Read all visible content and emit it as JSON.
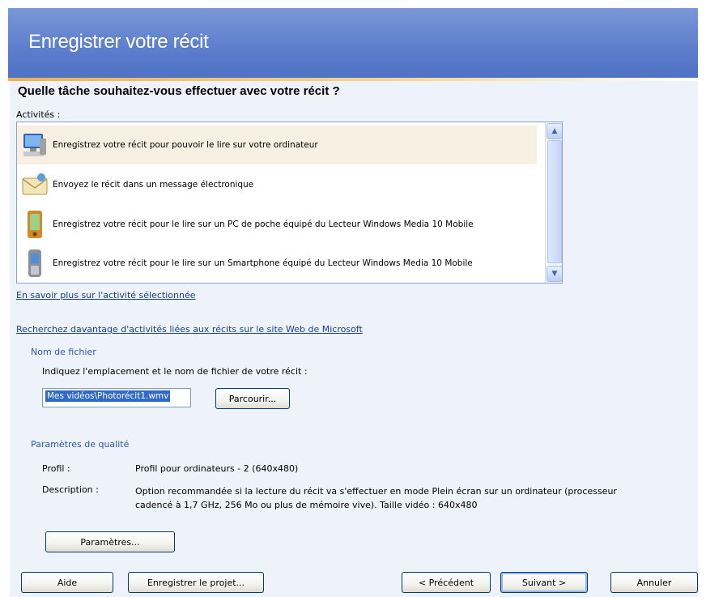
{
  "window": {
    "title": "Enregistrer votre récit"
  },
  "main": {
    "question": "Quelle tâche souhaitez-vous effectuer avec votre récit ?",
    "activities_label": "Activités :",
    "activities": [
      {
        "label": "Enregistrez votre récit pour pouvoir le lire sur votre ordinateur",
        "icon": "computer-icon",
        "selected": true
      },
      {
        "label": "Envoyez le récit dans un message électronique",
        "icon": "email-envelope-icon",
        "selected": false
      },
      {
        "label": "Enregistrez votre récit pour le lire sur un PC de poche équipé du Lecteur Windows Media 10 Mobile",
        "icon": "pocket-pc-icon",
        "selected": false
      },
      {
        "label": "Enregistrez votre récit pour le lire sur un Smartphone équipé du Lecteur Windows Media 10 Mobile",
        "icon": "smartphone-icon",
        "selected": false
      }
    ],
    "learn_more_link": "En savoir plus sur l'activité sélectionnée",
    "search_more_link": "Recherchez davantage d'activités liées aux récits sur le site Web de Microsoft"
  },
  "file": {
    "section_title": "Nom de fichier",
    "instruction": "Indiquez l'emplacement et le nom de fichier de votre récit :",
    "value": "Mes vidéos\\Photorécit1.wmv",
    "browse_label": "Parcourir..."
  },
  "quality": {
    "section_title": "Paramètres de qualité",
    "profile_label": "Profil :",
    "profile_value": "Profil pour ordinateurs - 2 (640x480)",
    "description_label": "Description :",
    "description_line1": "Option recommandée si la lecture du récit va s'effectuer en mode Plein écran sur un ordinateur (processeur",
    "description_line2": "cadencé à 1,7 GHz, 256 Mo ou plus de mémoire vive). Taille vidéo : 640x480",
    "settings_label": "Paramètres..."
  },
  "footer": {
    "help_label": "Aide",
    "save_project_label": "Enregistrer le projet...",
    "previous_label": "< Précédent",
    "next_label": "Suivant >",
    "cancel_label": "Annuler"
  },
  "colors": {
    "header": "#5e7fcc",
    "accent_line": "#f0b050",
    "link": "#1a3d9b",
    "section_title": "#2a55b5",
    "selection": "#f6efe2"
  }
}
